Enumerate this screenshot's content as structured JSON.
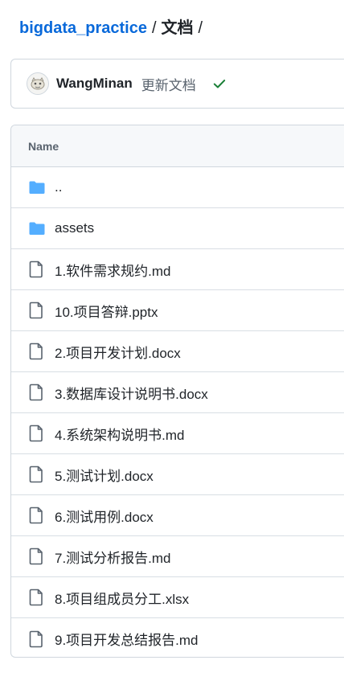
{
  "breadcrumb": {
    "repo": "bigdata_practice",
    "separator": "/",
    "current": "文档",
    "trailing": "/"
  },
  "commit": {
    "author": "WangMinan",
    "message": "更新文档",
    "status": "success",
    "status_color": "#1a7f37"
  },
  "table": {
    "header": "Name",
    "rows": [
      {
        "name": "..",
        "type": "folder"
      },
      {
        "name": "assets",
        "type": "folder"
      },
      {
        "name": "1.软件需求规约.md",
        "type": "file"
      },
      {
        "name": "10.项目答辩.pptx",
        "type": "file"
      },
      {
        "name": "2.项目开发计划.docx",
        "type": "file"
      },
      {
        "name": "3.数据库设计说明书.docx",
        "type": "file"
      },
      {
        "name": "4.系统架构说明书.md",
        "type": "file"
      },
      {
        "name": "5.测试计划.docx",
        "type": "file"
      },
      {
        "name": "6.测试用例.docx",
        "type": "file"
      },
      {
        "name": "7.测试分析报告.md",
        "type": "file"
      },
      {
        "name": "8.项目组成员分工.xlsx",
        "type": "file"
      },
      {
        "name": "9.项目开发总结报告.md",
        "type": "file"
      }
    ]
  },
  "colors": {
    "folder": "#54aeff",
    "link": "#0969da",
    "file_icon": "#59636e"
  }
}
